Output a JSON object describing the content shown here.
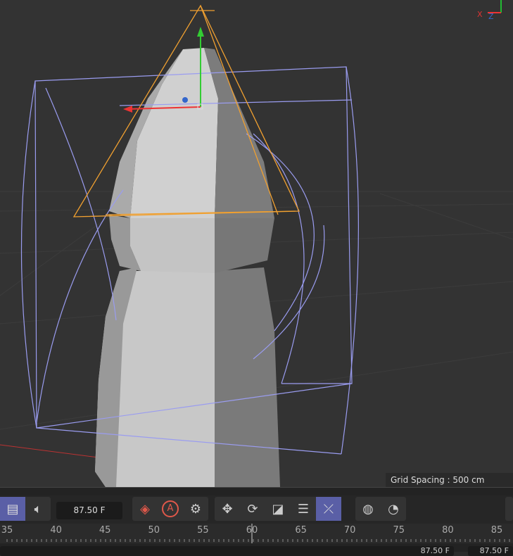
{
  "viewport": {
    "grid_spacing": "Grid Spacing : 500 cm",
    "axis_labels": {
      "x": "X",
      "z": "Z"
    }
  },
  "toolbar": {
    "current_frame": "87.50 F",
    "buttons": [
      {
        "name": "timeline-view-button",
        "icon": "film-icon",
        "active": true
      },
      {
        "name": "sound-button",
        "icon": "speaker-icon"
      },
      {
        "name": "record-keyframe-button",
        "icon": "keyframe-record-icon"
      },
      {
        "name": "autokey-button",
        "icon": "autokey-icon",
        "label": "A"
      },
      {
        "name": "key-settings-button",
        "icon": "gear-icon"
      },
      {
        "name": "key-position-button",
        "icon": "move-key-icon"
      },
      {
        "name": "key-rotation-button",
        "icon": "rotate-key-icon"
      },
      {
        "name": "key-scale-button",
        "icon": "scale-key-icon"
      },
      {
        "name": "key-param-button",
        "icon": "toggle-icon"
      },
      {
        "name": "key-pla-button",
        "icon": "pla-icon",
        "active": true
      },
      {
        "name": "mouse-button",
        "icon": "mouse-icon"
      },
      {
        "name": "speed-button",
        "icon": "gauge-icon"
      }
    ]
  },
  "timeline": {
    "ticks": [
      "35",
      "40",
      "45",
      "50",
      "55",
      "60",
      "65",
      "70",
      "75",
      "80",
      "85"
    ],
    "current": "60"
  },
  "bottom": {
    "start_frame": "87.50 F",
    "end_frame": "87.50 F"
  },
  "colors": {
    "accent": "#5a5fa6",
    "record": "#e0584a",
    "selection": "#f0a030",
    "deformer": "#9a9cf0"
  }
}
